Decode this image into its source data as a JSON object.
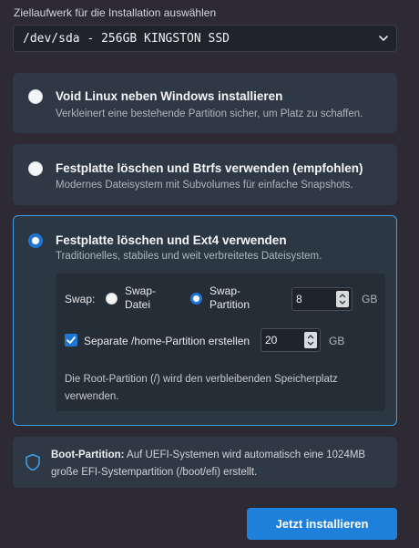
{
  "drive": {
    "label": "Ziellaufwerk für die Installation auswählen",
    "selected": "/dev/sda - 256GB KINGSTON SSD"
  },
  "options": [
    {
      "title": "Void Linux neben Windows installieren",
      "description": "Verkleinert eine bestehende Partition sicher, um Platz zu schaffen.",
      "selected": false
    },
    {
      "title": "Festplatte löschen und Btrfs verwenden (empfohlen)",
      "description": "Modernes Dateisystem mit Subvolumes für einfache Snapshots.",
      "selected": false
    },
    {
      "title": "Festplatte löschen und Ext4 verwenden",
      "description": "Traditionelles, stabiles und weit verbreitetes Dateisystem.",
      "selected": true
    }
  ],
  "ext4": {
    "swap_label": "Swap:",
    "swap_file_line1": "Swap-",
    "swap_file_line2": "Datei",
    "swap_partition_line1": "Swap-",
    "swap_partition_line2": "Partition",
    "swap_selected": "partition",
    "swap_size": "8",
    "swap_unit": "GB",
    "home_checkbox_label": "Separate /home-Partition erstellen",
    "home_checked": true,
    "home_size": "20",
    "home_unit": "GB",
    "note": "Die Root-Partition (/) wird den verbleibenden Speicherplatz verwenden."
  },
  "boot_info": {
    "title": "Boot-Partition:",
    "text": " Auf UEFI-Systemen wird automatisch eine 1024MB große EFI-Systempartition (/boot/efi) erstellt."
  },
  "install_button": "Jetzt installieren",
  "colors": {
    "background": "#2d2a33",
    "card": "#2f3945",
    "accent": "#1f80dc",
    "selected_border": "#3e9de8"
  },
  "icons": {
    "dropdown": "chevron-down-icon",
    "boot_info": "shield-icon"
  }
}
